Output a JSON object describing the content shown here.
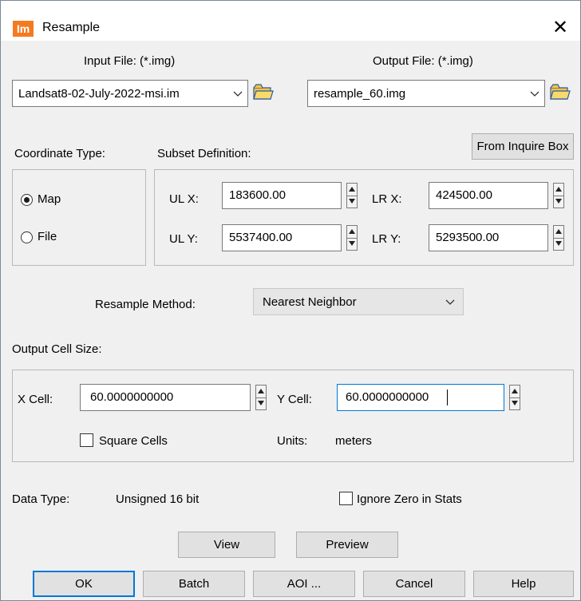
{
  "window": {
    "title": "Resample",
    "app_icon_text": "Im",
    "close_glyph": "✕"
  },
  "input_file": {
    "label": "Input File: (*.img)",
    "value": "Landsat8-02-July-2022-msi.im"
  },
  "output_file": {
    "label": "Output File: (*.img)",
    "value": "resample_60.img"
  },
  "coordinate_type": {
    "label": "Coordinate Type:",
    "options": [
      {
        "label": "Map",
        "selected": true
      },
      {
        "label": "File",
        "selected": false
      }
    ]
  },
  "subset": {
    "label": "Subset Definition:",
    "from_inquire_button": "From Inquire Box",
    "ul_x_label": "UL X:",
    "ul_x": "183600.00",
    "ul_y_label": "UL Y:",
    "ul_y": "5537400.00",
    "lr_x_label": "LR X:",
    "lr_x": "424500.00",
    "lr_y_label": "LR Y:",
    "lr_y": "5293500.00"
  },
  "resample_method": {
    "label": "Resample Method:",
    "value": "Nearest Neighbor"
  },
  "output_cell_size": {
    "label": "Output Cell Size:",
    "x_label": "X Cell:",
    "x_value": "60.0000000000",
    "y_label": "Y Cell:",
    "y_value": "60.0000000000",
    "square_cells_label": "Square Cells",
    "square_cells_checked": false,
    "units_label": "Units:",
    "units_value": "meters"
  },
  "data_type": {
    "label": "Data Type:",
    "value": "Unsigned 16 bit",
    "ignore_zero_label": "Ignore Zero in Stats",
    "ignore_zero_checked": false
  },
  "buttons": {
    "view": "View",
    "preview": "Preview",
    "ok": "OK",
    "batch": "Batch",
    "aoi": "AOI ...",
    "cancel": "Cancel",
    "help": "Help"
  },
  "colors": {
    "accent": "#0078d7",
    "app_icon": "#f47a20",
    "folder": "#f5c542"
  }
}
